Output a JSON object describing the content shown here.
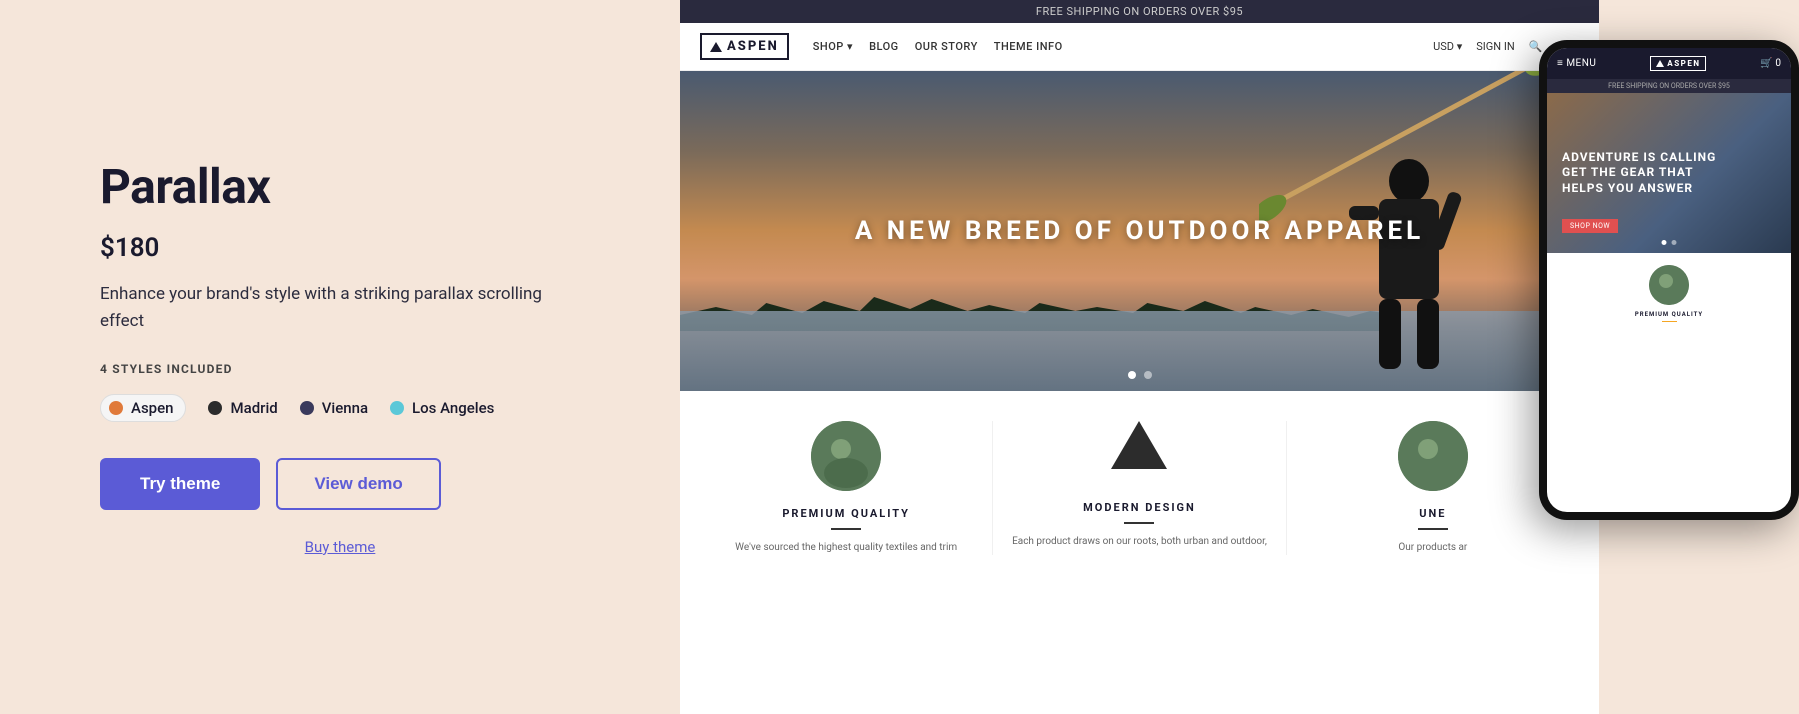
{
  "left": {
    "theme_name": "Parallax",
    "price": "$180",
    "description": "Enhance your brand's style with a striking parallax scrolling effect",
    "styles_label": "4 STYLES INCLUDED",
    "styles": [
      {
        "id": "aspen",
        "name": "Aspen",
        "color": "#e07a3a",
        "active": true
      },
      {
        "id": "madrid",
        "name": "Madrid",
        "color": "#2c2c2c",
        "active": false
      },
      {
        "id": "vienna",
        "name": "Vienna",
        "color": "#3a3a5c",
        "active": false
      },
      {
        "id": "la",
        "name": "Los Angeles",
        "color": "#5bc8d8",
        "active": false
      }
    ],
    "try_button": "Try theme",
    "demo_button": "View demo",
    "buy_link": "Buy theme"
  },
  "desktop_preview": {
    "announcement": "FREE SHIPPING ON ORDERS OVER $95",
    "nav": {
      "logo_text": "ASPEN",
      "links": [
        "SHOP ▾",
        "BLOG",
        "OUR STORY",
        "THEME INFO"
      ],
      "right": [
        "USD ▾",
        "SIGN IN",
        "🔍",
        "🛒 0"
      ]
    },
    "hero_text": "A NEW BREED OF OUTDOOR APPAREL",
    "features": [
      {
        "type": "circle",
        "title": "PREMIUM QUALITY",
        "desc": "We've sourced the highest quality textiles and trim"
      },
      {
        "type": "triangle",
        "title": "MODERN DESIGN",
        "desc": "Each product draws on our roots, both urban and outdoor,"
      },
      {
        "type": "circle",
        "title": "UNE",
        "desc": "Our products ar"
      }
    ]
  },
  "mobile_preview": {
    "announcement": "FREE SHIPPING ON ORDERS OVER $95",
    "logo_text": "ASPEN",
    "hero_text": "ADVENTURE IS CALLING\nGET THE GEAR THAT HELPS YOU ANSWER",
    "shop_btn": "SHOP NOW",
    "feature_title": "PREMIUM QUALITY"
  },
  "colors": {
    "background": "#f5e6da",
    "primary_button": "#5b5bd6",
    "link": "#5b5bd6",
    "dark_nav": "#1a1a2e"
  }
}
